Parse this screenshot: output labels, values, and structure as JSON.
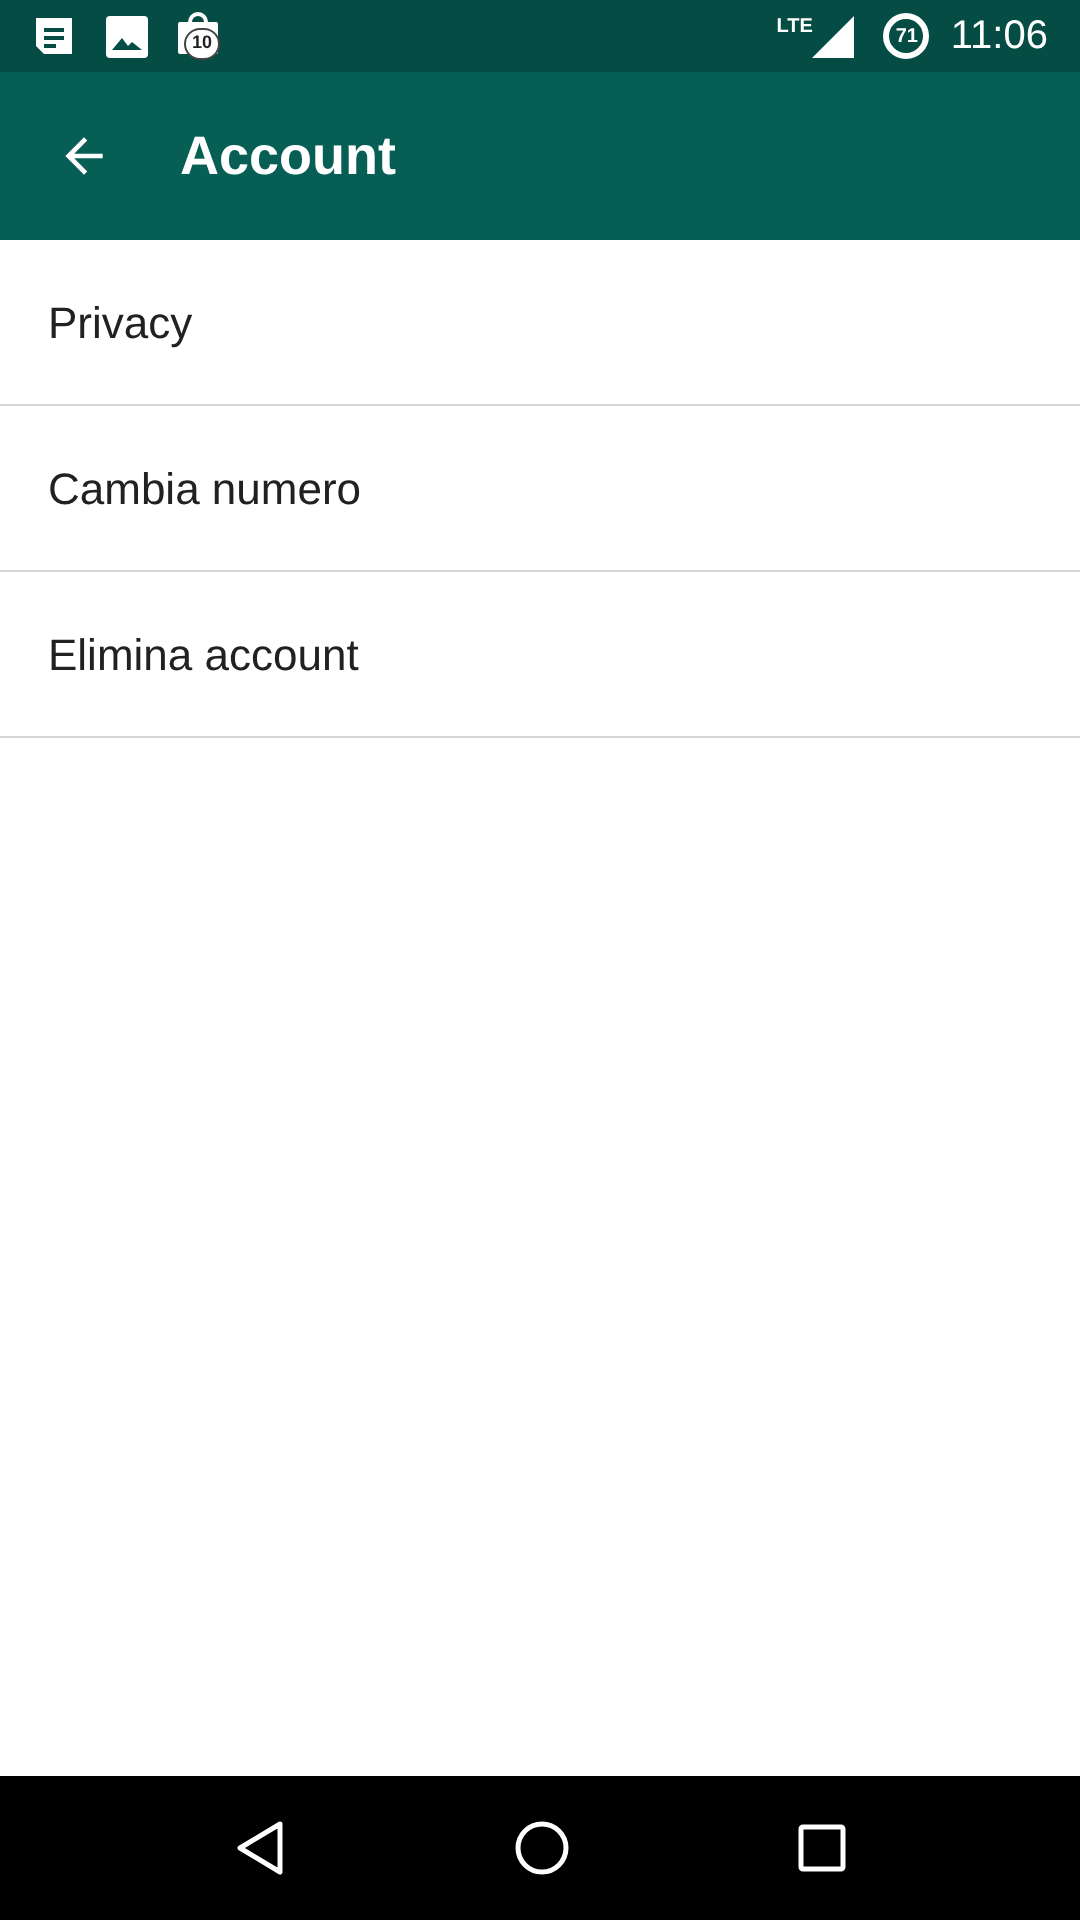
{
  "status_bar": {
    "badge_count": "10",
    "network": "LTE",
    "battery": "71",
    "time": "11:06"
  },
  "app_bar": {
    "title": "Account"
  },
  "items": [
    {
      "label": "Privacy"
    },
    {
      "label": "Cambia numero"
    },
    {
      "label": "Elimina account"
    }
  ]
}
